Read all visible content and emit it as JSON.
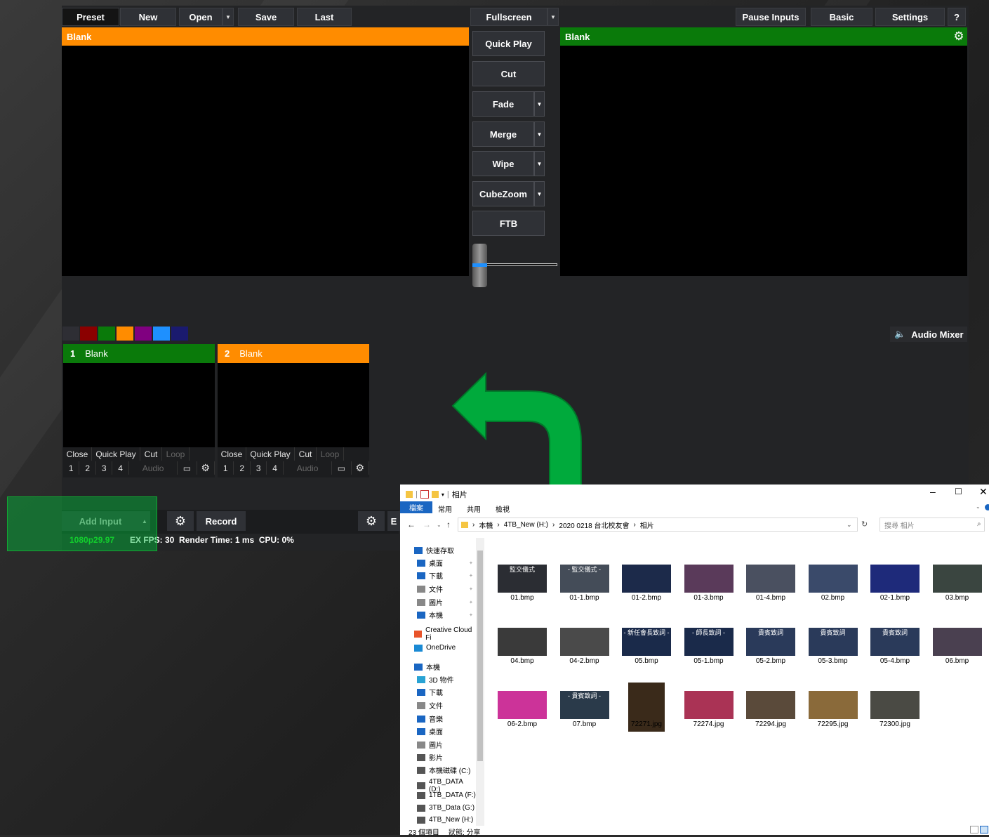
{
  "toolbar": {
    "preset": "Preset",
    "new": "New",
    "open": "Open",
    "save": "Save",
    "last": "Last",
    "fullscreen": "Fullscreen",
    "pause_inputs": "Pause Inputs",
    "basic": "Basic",
    "settings": "Settings",
    "help": "?"
  },
  "preview": {
    "title": "Blank"
  },
  "output": {
    "title": "Blank"
  },
  "transitions": [
    "Quick Play",
    "Cut",
    "Fade",
    "Merge",
    "Wipe",
    "CubeZoom",
    "FTB"
  ],
  "colors": {
    "preview_bar": "#ff8c00",
    "output_bar": "#0a7a0a",
    "accent_blue": "#1e90ff",
    "swatches": [
      "#2e2e34",
      "#8b0000",
      "#0a7a0a",
      "#ff8c00",
      "#800080",
      "#1e90ff",
      "#1a1a6e"
    ]
  },
  "audio_mixer": "Audio Mixer",
  "inputs": [
    {
      "number": "1",
      "title": "Blank",
      "color": "#0a7a0a"
    },
    {
      "number": "2",
      "title": "Blank",
      "color": "#ff8c00"
    }
  ],
  "input_controls": {
    "close": "Close",
    "quick_play": "Quick Play",
    "cut": "Cut",
    "loop": "Loop",
    "n1": "1",
    "n2": "2",
    "n3": "3",
    "n4": "4",
    "audio": "Audio"
  },
  "bottom": {
    "add_input": "Add Input",
    "record": "Record",
    "format": "1080p29.97",
    "stats": "EX FPS: 30  Render Time: 1 ms  CPU: 0%",
    "cut_letter": "E"
  },
  "explorer": {
    "title": "相片",
    "tabs": [
      "檔案",
      "常用",
      "共用",
      "檢視"
    ],
    "path": [
      "本機",
      "4TB_New (H:)",
      "2020 0218 台北校友會",
      "相片"
    ],
    "search_placeholder": "搜尋 相片",
    "nav": [
      "快速存取",
      "桌面",
      "下載",
      "文件",
      "圖片",
      "本機",
      "Creative Cloud Fi",
      "OneDrive",
      "本機",
      "3D 物件",
      "下載",
      "文件",
      "音樂",
      "桌面",
      "圖片",
      "影片",
      "本機磁碟 (C:)",
      "4TB_DATA (D:)",
      "1TB_DATA (F:)",
      "3TB_Data (G:)",
      "4TB_New (H:)"
    ],
    "files": [
      {
        "name": "01.bmp",
        "tc": "監交儀式"
      },
      {
        "name": "01-1.bmp",
        "tc": "- 監交儀式 -"
      },
      {
        "name": "01-2.bmp",
        "tc": ""
      },
      {
        "name": "01-3.bmp",
        "tc": ""
      },
      {
        "name": "01-4.bmp",
        "tc": ""
      },
      {
        "name": "02.bmp",
        "tc": ""
      },
      {
        "name": "02-1.bmp",
        "tc": ""
      },
      {
        "name": "03.bmp",
        "tc": ""
      },
      {
        "name": "04.bmp",
        "tc": ""
      },
      {
        "name": "04-2.bmp",
        "tc": ""
      },
      {
        "name": "05.bmp",
        "tc": "- 新任會長致詞 -"
      },
      {
        "name": "05-1.bmp",
        "tc": "- 師長致詞 -"
      },
      {
        "name": "05-2.bmp",
        "tc": "貴賓致詞"
      },
      {
        "name": "05-3.bmp",
        "tc": "貴賓致詞"
      },
      {
        "name": "05-4.bmp",
        "tc": "貴賓致詞"
      },
      {
        "name": "06.bmp",
        "tc": ""
      },
      {
        "name": "06-2.bmp",
        "tc": ""
      },
      {
        "name": "07.bmp",
        "tc": "- 貴賓致詞 -"
      },
      {
        "name": "72271.jpg",
        "tc": ""
      },
      {
        "name": "72274.jpg",
        "tc": ""
      },
      {
        "name": "72294.jpg",
        "tc": ""
      },
      {
        "name": "72295.jpg",
        "tc": ""
      },
      {
        "name": "72300.jpg",
        "tc": ""
      }
    ],
    "status_count": "23 個項目",
    "status_share": "狀態: 分享"
  }
}
